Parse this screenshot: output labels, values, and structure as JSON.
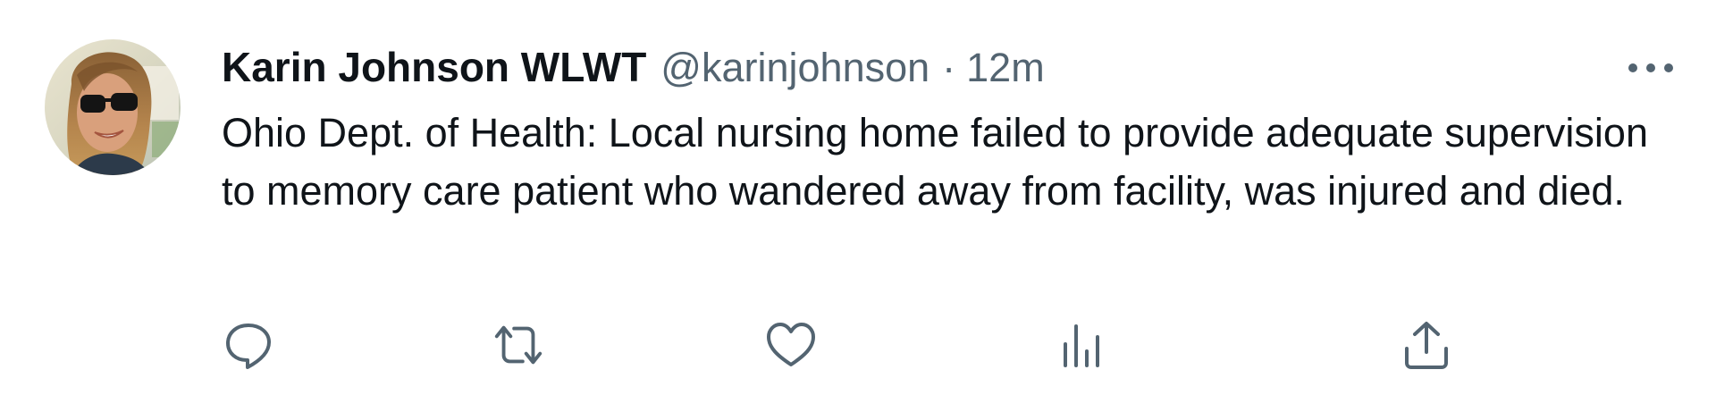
{
  "tweet": {
    "author": {
      "display_name": "Karin Johnson WLWT",
      "handle": "@karinjohnson"
    },
    "separator": "·",
    "timestamp": "12m",
    "text": "Ohio Dept. of Health: Local nursing home failed to provide adequate supervision to memory care patient who wandered away from facility, was injured and died.",
    "actions": [
      {
        "name": "reply",
        "icon": "speech-bubble-icon"
      },
      {
        "name": "retweet",
        "icon": "retweet-icon"
      },
      {
        "name": "like",
        "icon": "heart-icon"
      },
      {
        "name": "analytics",
        "icon": "bar-chart-icon"
      },
      {
        "name": "share",
        "icon": "share-upload-icon"
      }
    ]
  },
  "colors": {
    "text_primary": "#0f1419",
    "text_secondary": "#536471",
    "background": "#ffffff"
  }
}
